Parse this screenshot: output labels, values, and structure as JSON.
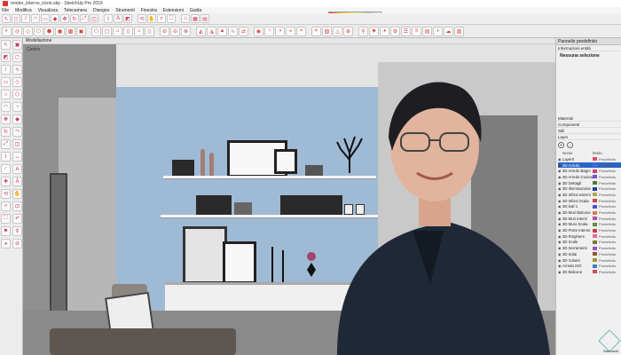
{
  "window": {
    "title": "render_interno_inizio.skp - SketchUp Pro 2019"
  },
  "menu": [
    "File",
    "Modifica",
    "Visualizza",
    "Telecamera",
    "Disegno",
    "Strumenti",
    "Finestra",
    "Estensioni",
    "Guida"
  ],
  "shadow_bar": {
    "time_label": "07:15 AM",
    "noon_label": "Mezzogiorno",
    "end_label": "04:36 PM"
  },
  "viewport": {
    "tab_label": "Modellazione",
    "scene_label": "Centro"
  },
  "right_panel": {
    "title": "Pannello predefinito",
    "entity_info": "Informazioni entità",
    "no_selection": "Nessuna selezione",
    "materials": "Materiali",
    "components": "Componenti",
    "styles": "Stili",
    "layers": "Layer",
    "header_name": "Nome",
    "header_mode": "Modo",
    "layers_list": [
      {
        "name": "Layer0",
        "color": "#e04c6a",
        "mode": "Predefinito",
        "selected": false
      },
      {
        "name": "3D Arredo",
        "color": "#3d6fe0",
        "mode": "Predefinito",
        "selected": true
      },
      {
        "name": "3D Arredo Bagni",
        "color": "#c6417f",
        "mode": "Predefinito",
        "selected": false
      },
      {
        "name": "3D Arredo Cucina",
        "color": "#7b4fd6",
        "mode": "Predefinito",
        "selected": false
      },
      {
        "name": "3D Dettagli",
        "color": "#4e7d3a",
        "mode": "Predefinito",
        "selected": false
      },
      {
        "name": "3D Illuminazione",
        "color": "#1f3ea8",
        "mode": "Predefinito",
        "selected": false
      },
      {
        "name": "3D Infissi esterni",
        "color": "#b9a14c",
        "mode": "Predefinito",
        "selected": false
      },
      {
        "name": "3D Infissi Scala",
        "color": "#c94848",
        "mode": "Predefinito",
        "selected": false
      },
      {
        "name": "3D leaf 1",
        "color": "#4f4fc9",
        "mode": "Predefinito",
        "selected": false
      },
      {
        "name": "3D Muri Balcone",
        "color": "#d0804a",
        "mode": "Predefinito",
        "selected": false
      },
      {
        "name": "3D Muri Interni",
        "color": "#b34ca8",
        "mode": "Predefinito",
        "selected": false
      },
      {
        "name": "3D Muro Scala",
        "color": "#5c8f3b",
        "mode": "Predefinito",
        "selected": false
      },
      {
        "name": "3D Porte Interne",
        "color": "#c73f3f",
        "mode": "Predefinito",
        "selected": false
      },
      {
        "name": "3D Ringhiere",
        "color": "#e36f93",
        "mode": "Predefinito",
        "selected": false
      },
      {
        "name": "3D Scale",
        "color": "#7a7a2f",
        "mode": "Predefinito",
        "selected": false
      },
      {
        "name": "3D Serramenti",
        "color": "#a04fc0",
        "mode": "Predefinito",
        "selected": false
      },
      {
        "name": "3D Solai",
        "color": "#8c5a30",
        "mode": "Predefinito",
        "selected": false
      },
      {
        "name": "3D Volumi",
        "color": "#9b9b2f",
        "mode": "Predefinito",
        "selected": false
      },
      {
        "name": "Arredo ISO",
        "color": "#3f7ec7",
        "mode": "Predefinito",
        "selected": false
      },
      {
        "name": "3D Balcone",
        "color": "#c84f4f",
        "mode": "Predefinito",
        "selected": false
      }
    ],
    "status": "Strumenti"
  }
}
